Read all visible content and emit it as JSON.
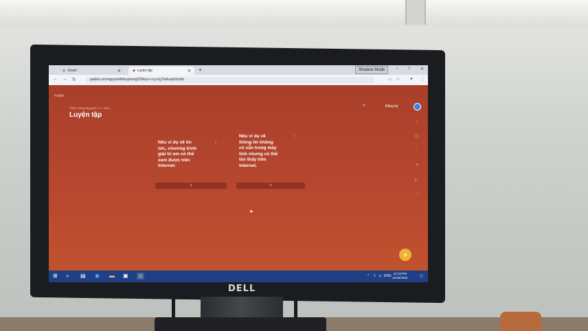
{
  "browser": {
    "tabs": [
      {
        "label": "Gmail",
        "active": false
      },
      {
        "label": "Luyện tập",
        "active": true
      }
    ],
    "new_tab": "+",
    "extension_badge": "Shadow Mode",
    "window_controls": [
      "–",
      "□",
      "✕"
    ],
    "url": "padlet.com/nguyenthithuytrang235/luy-n-t-p-trg7lottvzpk3vdxb"
  },
  "padlet": {
    "brand": "Padlet",
    "author_line": "Thủy Trang Nguyen • 1 • 41m",
    "title": "Luyện tập",
    "signup_label": "Đăng ký",
    "posts": [
      {
        "text": "Nêu ví dụ về tin\ntức, chương trình\ngiải trí em có thể\nxem được trên\nInternet.",
        "menu": "⋮",
        "add": "+"
      },
      {
        "text": "Nêu ví dụ về\nthông tin không\ncó sẵn trong máy\ntính nhưng có thể\ntìm thấy trên\nInternet.",
        "menu": "⋮",
        "add": "+"
      }
    ],
    "fab": "+",
    "side_tools": [
      "heart-icon",
      "comment-icon",
      "bell-icon",
      "share-icon",
      "slideshow-icon",
      "more-icon"
    ]
  },
  "taskbar": {
    "language": "ENG",
    "time": "12:13 PM",
    "date": "12/18/2024"
  },
  "monitor": {
    "brand": "DELL"
  },
  "colors": {
    "padlet_bg": "#b7472f",
    "taskbar": "#1f3f86",
    "fab": "#f0b233",
    "avatar": "#3d7ef0"
  }
}
